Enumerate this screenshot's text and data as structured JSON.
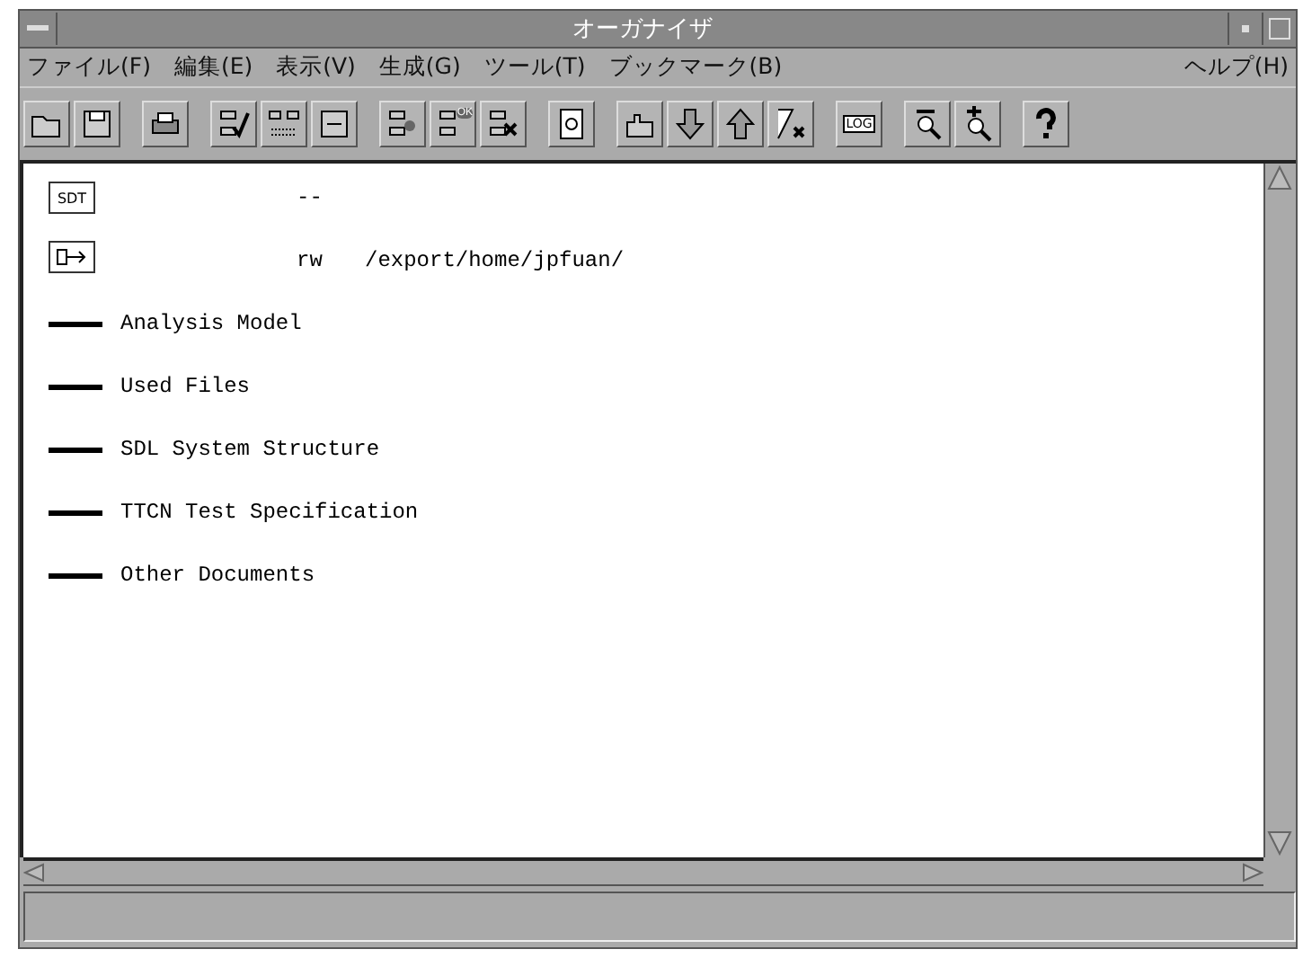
{
  "window": {
    "title": "オーガナイザ"
  },
  "menu": [
    {
      "label": "ファイル(F)"
    },
    {
      "label": "編集(E)"
    },
    {
      "label": "表示(V)"
    },
    {
      "label": "生成(G)"
    },
    {
      "label": "ツール(T)"
    },
    {
      "label": "ブックマーク(B)"
    }
  ],
  "help_menu": {
    "label": "ヘルプ(H)"
  },
  "toolbar": {
    "ok_badge": "OK",
    "log_label": "LOG"
  },
  "entries": [
    {
      "kind": "sdt",
      "icon_label": "SDT",
      "mode": "--"
    },
    {
      "kind": "link",
      "mode": "rw",
      "path": "/export/home/jpfuan/"
    },
    {
      "kind": "chapter",
      "name": "Analysis Model"
    },
    {
      "kind": "chapter",
      "name": "Used Files"
    },
    {
      "kind": "chapter",
      "name": "SDL System Structure"
    },
    {
      "kind": "chapter",
      "name": "TTCN Test Specification"
    },
    {
      "kind": "chapter",
      "name": "Other Documents"
    }
  ]
}
